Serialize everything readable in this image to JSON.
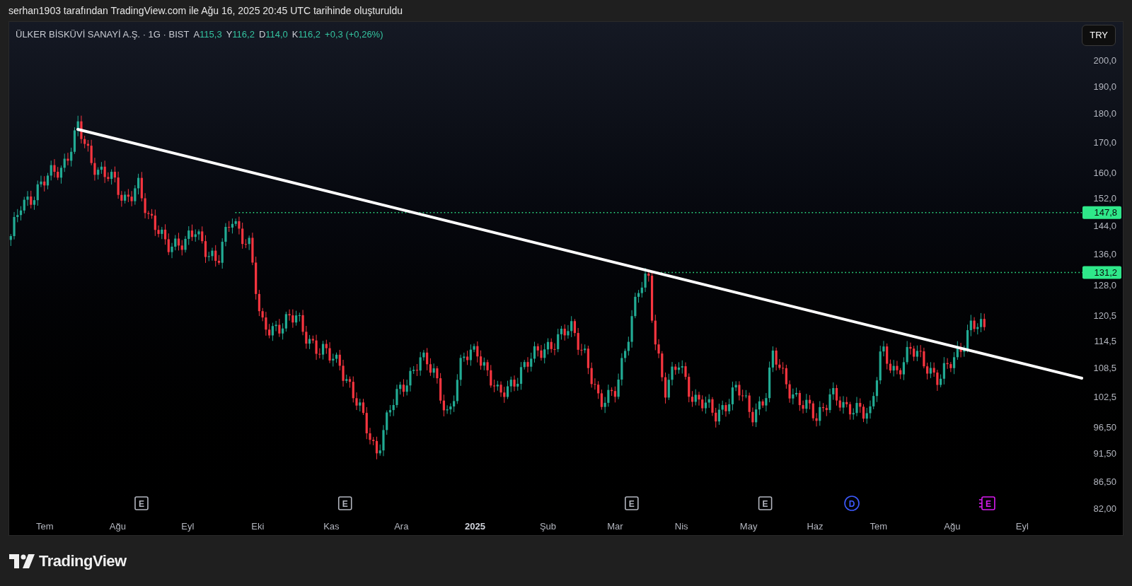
{
  "caption": "serhan1903 tarafından TradingView.com ile Ağu 16, 2025 20:45 UTC tarihinde oluşturuldu",
  "legend": {
    "symbol": "ÜLKER BİSKÜVİ SANAYİ A.Ş. · 1G · BIST",
    "ohlc": [
      {
        "letter": "A",
        "value": "115,3"
      },
      {
        "letter": "Y",
        "value": "116,2"
      },
      {
        "letter": "D",
        "value": "114,0"
      },
      {
        "letter": "K",
        "value": "116,2"
      }
    ],
    "change": "+0,3 (+0,26%)"
  },
  "currency_button": "TRY",
  "price_axis": {
    "labels": [
      "200,0",
      "190,0",
      "180,0",
      "170,0",
      "160,0",
      "152,0",
      "144,0",
      "136,0",
      "128,0",
      "120,5",
      "114,5",
      "108,5",
      "102,5",
      "96,50",
      "91,50",
      "86,50",
      "82,00"
    ]
  },
  "price_levels": [
    {
      "label": "147,8"
    },
    {
      "label": "131,2"
    }
  ],
  "events": [
    {
      "kind": "earnings",
      "label": "E"
    },
    {
      "kind": "earnings",
      "label": "E"
    },
    {
      "kind": "earnings",
      "label": "E"
    },
    {
      "kind": "earnings",
      "label": "E"
    },
    {
      "kind": "dividend",
      "label": "D"
    },
    {
      "kind": "upcoming_earnings",
      "label": "E"
    }
  ],
  "time_axis": {
    "labels": [
      {
        "text": "Tem",
        "bold": false
      },
      {
        "text": "Ağu",
        "bold": false
      },
      {
        "text": "Eyl",
        "bold": false
      },
      {
        "text": "Eki",
        "bold": false
      },
      {
        "text": "Kas",
        "bold": false
      },
      {
        "text": "Ara",
        "bold": false
      },
      {
        "text": "2025",
        "bold": true
      },
      {
        "text": "Şub",
        "bold": false
      },
      {
        "text": "Mar",
        "bold": false
      },
      {
        "text": "Nis",
        "bold": false
      },
      {
        "text": "May",
        "bold": false
      },
      {
        "text": "Haz",
        "bold": false
      },
      {
        "text": "Tem",
        "bold": false
      },
      {
        "text": "Ağu",
        "bold": false
      },
      {
        "text": "Eyl",
        "bold": false
      }
    ]
  },
  "footer": {
    "brand": "TradingView"
  }
}
